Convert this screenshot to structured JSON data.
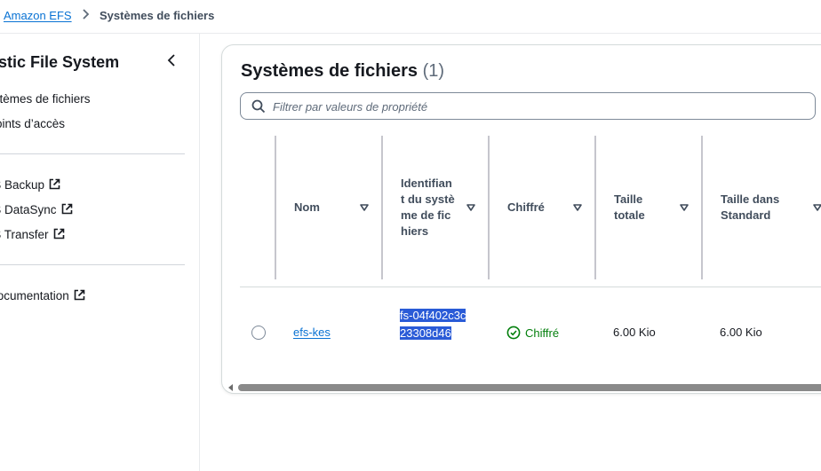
{
  "breadcrumb": {
    "root": "Amazon EFS",
    "current": "Systèmes de fichiers"
  },
  "sidebar": {
    "title": "Elastic File System",
    "items": [
      {
        "label": "Systèmes de fichiers"
      },
      {
        "label": "Points d’accès"
      }
    ],
    "external_links": [
      {
        "label": "AWS Backup",
        "icon": "external-link-icon"
      },
      {
        "label": "AWS DataSync",
        "icon": "external-link-icon"
      },
      {
        "label": "AWS Transfer",
        "icon": "external-link-icon"
      }
    ],
    "documentation": {
      "label": "Documentation",
      "icon": "external-link-icon"
    }
  },
  "main": {
    "title": "Systèmes de fichiers",
    "count": "(1)",
    "filter_placeholder": "Filtrer par valeurs de propriété",
    "columns": [
      {
        "label": "Nom"
      },
      {
        "label": "Identifiant du système de fichiers"
      },
      {
        "label": "Chiffré"
      },
      {
        "label": "Taille totale"
      },
      {
        "label": "Taille dans Standard"
      }
    ],
    "rows": [
      {
        "name": "efs-kes",
        "id": "fs-04f402c3c23308d46",
        "encrypted": "Chiffré",
        "total_size": "6.00 Kio",
        "standard_size": "6.00 Kio"
      }
    ]
  },
  "colors": {
    "link": "#0972d3",
    "success": "#037f0c",
    "selection": "#2a5bd7"
  }
}
